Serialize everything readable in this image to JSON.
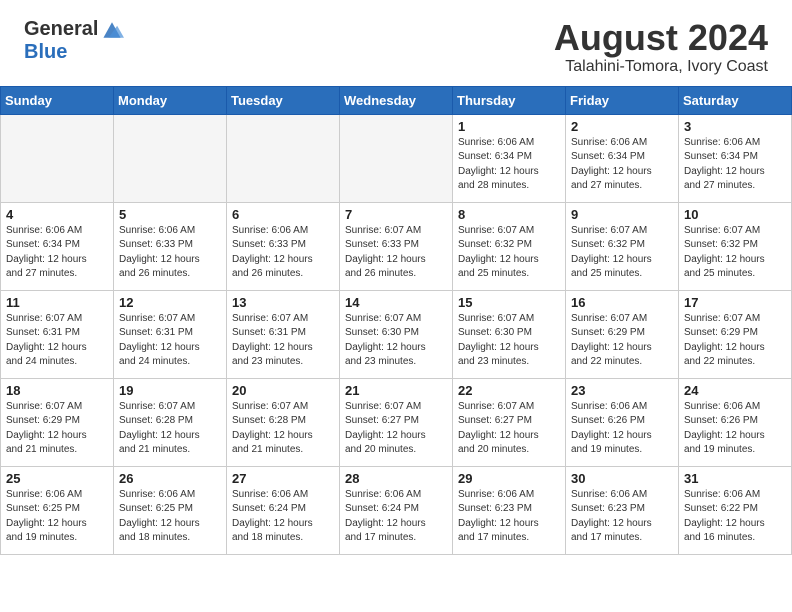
{
  "header": {
    "logo_general": "General",
    "logo_blue": "Blue",
    "month_year": "August 2024",
    "location": "Talahini-Tomora, Ivory Coast"
  },
  "weekdays": [
    "Sunday",
    "Monday",
    "Tuesday",
    "Wednesday",
    "Thursday",
    "Friday",
    "Saturday"
  ],
  "weeks": [
    [
      {
        "day": "",
        "info": ""
      },
      {
        "day": "",
        "info": ""
      },
      {
        "day": "",
        "info": ""
      },
      {
        "day": "",
        "info": ""
      },
      {
        "day": "1",
        "info": "Sunrise: 6:06 AM\nSunset: 6:34 PM\nDaylight: 12 hours\nand 28 minutes."
      },
      {
        "day": "2",
        "info": "Sunrise: 6:06 AM\nSunset: 6:34 PM\nDaylight: 12 hours\nand 27 minutes."
      },
      {
        "day": "3",
        "info": "Sunrise: 6:06 AM\nSunset: 6:34 PM\nDaylight: 12 hours\nand 27 minutes."
      }
    ],
    [
      {
        "day": "4",
        "info": "Sunrise: 6:06 AM\nSunset: 6:34 PM\nDaylight: 12 hours\nand 27 minutes."
      },
      {
        "day": "5",
        "info": "Sunrise: 6:06 AM\nSunset: 6:33 PM\nDaylight: 12 hours\nand 26 minutes."
      },
      {
        "day": "6",
        "info": "Sunrise: 6:06 AM\nSunset: 6:33 PM\nDaylight: 12 hours\nand 26 minutes."
      },
      {
        "day": "7",
        "info": "Sunrise: 6:07 AM\nSunset: 6:33 PM\nDaylight: 12 hours\nand 26 minutes."
      },
      {
        "day": "8",
        "info": "Sunrise: 6:07 AM\nSunset: 6:32 PM\nDaylight: 12 hours\nand 25 minutes."
      },
      {
        "day": "9",
        "info": "Sunrise: 6:07 AM\nSunset: 6:32 PM\nDaylight: 12 hours\nand 25 minutes."
      },
      {
        "day": "10",
        "info": "Sunrise: 6:07 AM\nSunset: 6:32 PM\nDaylight: 12 hours\nand 25 minutes."
      }
    ],
    [
      {
        "day": "11",
        "info": "Sunrise: 6:07 AM\nSunset: 6:31 PM\nDaylight: 12 hours\nand 24 minutes."
      },
      {
        "day": "12",
        "info": "Sunrise: 6:07 AM\nSunset: 6:31 PM\nDaylight: 12 hours\nand 24 minutes."
      },
      {
        "day": "13",
        "info": "Sunrise: 6:07 AM\nSunset: 6:31 PM\nDaylight: 12 hours\nand 23 minutes."
      },
      {
        "day": "14",
        "info": "Sunrise: 6:07 AM\nSunset: 6:30 PM\nDaylight: 12 hours\nand 23 minutes."
      },
      {
        "day": "15",
        "info": "Sunrise: 6:07 AM\nSunset: 6:30 PM\nDaylight: 12 hours\nand 23 minutes."
      },
      {
        "day": "16",
        "info": "Sunrise: 6:07 AM\nSunset: 6:29 PM\nDaylight: 12 hours\nand 22 minutes."
      },
      {
        "day": "17",
        "info": "Sunrise: 6:07 AM\nSunset: 6:29 PM\nDaylight: 12 hours\nand 22 minutes."
      }
    ],
    [
      {
        "day": "18",
        "info": "Sunrise: 6:07 AM\nSunset: 6:29 PM\nDaylight: 12 hours\nand 21 minutes."
      },
      {
        "day": "19",
        "info": "Sunrise: 6:07 AM\nSunset: 6:28 PM\nDaylight: 12 hours\nand 21 minutes."
      },
      {
        "day": "20",
        "info": "Sunrise: 6:07 AM\nSunset: 6:28 PM\nDaylight: 12 hours\nand 21 minutes."
      },
      {
        "day": "21",
        "info": "Sunrise: 6:07 AM\nSunset: 6:27 PM\nDaylight: 12 hours\nand 20 minutes."
      },
      {
        "day": "22",
        "info": "Sunrise: 6:07 AM\nSunset: 6:27 PM\nDaylight: 12 hours\nand 20 minutes."
      },
      {
        "day": "23",
        "info": "Sunrise: 6:06 AM\nSunset: 6:26 PM\nDaylight: 12 hours\nand 19 minutes."
      },
      {
        "day": "24",
        "info": "Sunrise: 6:06 AM\nSunset: 6:26 PM\nDaylight: 12 hours\nand 19 minutes."
      }
    ],
    [
      {
        "day": "25",
        "info": "Sunrise: 6:06 AM\nSunset: 6:25 PM\nDaylight: 12 hours\nand 19 minutes."
      },
      {
        "day": "26",
        "info": "Sunrise: 6:06 AM\nSunset: 6:25 PM\nDaylight: 12 hours\nand 18 minutes."
      },
      {
        "day": "27",
        "info": "Sunrise: 6:06 AM\nSunset: 6:24 PM\nDaylight: 12 hours\nand 18 minutes."
      },
      {
        "day": "28",
        "info": "Sunrise: 6:06 AM\nSunset: 6:24 PM\nDaylight: 12 hours\nand 17 minutes."
      },
      {
        "day": "29",
        "info": "Sunrise: 6:06 AM\nSunset: 6:23 PM\nDaylight: 12 hours\nand 17 minutes."
      },
      {
        "day": "30",
        "info": "Sunrise: 6:06 AM\nSunset: 6:23 PM\nDaylight: 12 hours\nand 17 minutes."
      },
      {
        "day": "31",
        "info": "Sunrise: 6:06 AM\nSunset: 6:22 PM\nDaylight: 12 hours\nand 16 minutes."
      }
    ]
  ]
}
